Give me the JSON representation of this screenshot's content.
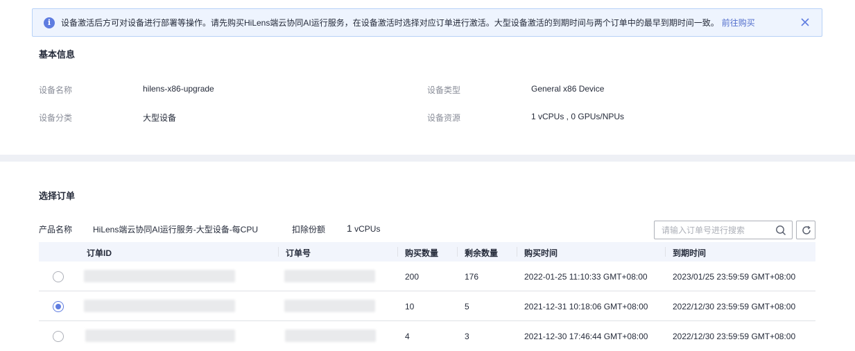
{
  "notice": {
    "text": "设备激活后方可对设备进行部署等操作。请先购买HiLens端云协同AI运行服务，在设备激活时选择对应订单进行激活。大型设备激活的到期时间与两个订单中的最早到期时间一致。",
    "link": "前往购买",
    "icon": "info-icon",
    "accent": "#5e7ce0"
  },
  "basic_info": {
    "title": "基本信息",
    "fields": [
      {
        "label": "设备名称",
        "value": "hilens-x86-upgrade"
      },
      {
        "label": "设备类型",
        "value": "General x86 Device"
      },
      {
        "label": "设备分类",
        "value": "大型设备"
      },
      {
        "label": "设备资源",
        "value": "1 vCPUs , 0 GPUs/NPUs"
      }
    ]
  },
  "order_section": {
    "title": "选择订单",
    "product_label": "产品名称",
    "product_value": "HiLens端云协同AI运行服务-大型设备-每CPU",
    "deduct_label": "扣除份额",
    "deduct_number": "1",
    "deduct_unit": " vCPUs",
    "search_placeholder": "请输入订单号进行搜索"
  },
  "table": {
    "columns": [
      "订单ID",
      "订单号",
      "购买数量",
      "剩余数量",
      "购买时间",
      "到期时间"
    ],
    "rows": [
      {
        "selected": false,
        "order_id": "",
        "order_no": "",
        "bought": "200",
        "remaining": "176",
        "buy_time": "2022-01-25 11:10:33 GMT+08:00",
        "expire_time": "2023/01/25 23:59:59 GMT+08:00"
      },
      {
        "selected": true,
        "order_id": "",
        "order_no": "",
        "bought": "10",
        "remaining": "5",
        "buy_time": "2021-12-31 10:18:06 GMT+08:00",
        "expire_time": "2022/12/30 23:59:59 GMT+08:00"
      },
      {
        "selected": false,
        "order_id": "",
        "order_no": "",
        "bought": "4",
        "remaining": "3",
        "buy_time": "2021-12-30 17:46:44 GMT+08:00",
        "expire_time": "2022/12/30 23:59:59 GMT+08:00"
      }
    ]
  }
}
